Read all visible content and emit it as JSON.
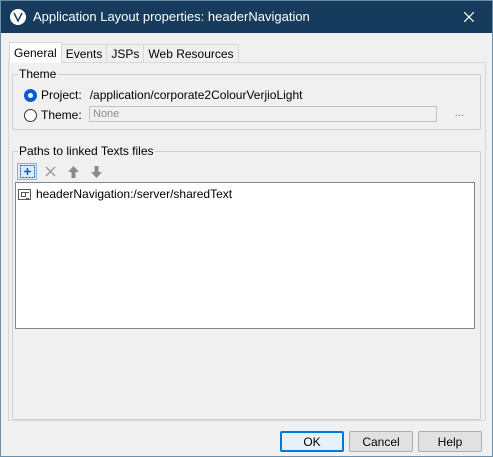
{
  "window": {
    "title": "Application Layout properties: headerNavigation",
    "app_icon_letter": "V",
    "colors": {
      "titlebar": "#163b5c",
      "accent": "#0a5bd3"
    }
  },
  "tabs": [
    {
      "label": "General",
      "active": true
    },
    {
      "label": "Events",
      "active": false
    },
    {
      "label": "JSPs",
      "active": false
    },
    {
      "label": "Web Resources",
      "active": false
    }
  ],
  "theme_group": {
    "title": "Theme",
    "project": {
      "label": "Project:",
      "value": "/application/corporate2ColourVerjioLight",
      "selected": true
    },
    "theme": {
      "label": "Theme:",
      "value": "None",
      "selected": false,
      "browse_label": "..."
    }
  },
  "paths_group": {
    "title": "Paths to linked Texts files",
    "toolbar": [
      "add-icon",
      "delete-icon",
      "move-up-icon",
      "move-down-icon"
    ],
    "items": [
      {
        "label": "headerNavigation:/server/sharedText",
        "icon": "text-resource-icon"
      }
    ]
  },
  "buttons": {
    "ok": "OK",
    "cancel": "Cancel",
    "help": "Help"
  }
}
